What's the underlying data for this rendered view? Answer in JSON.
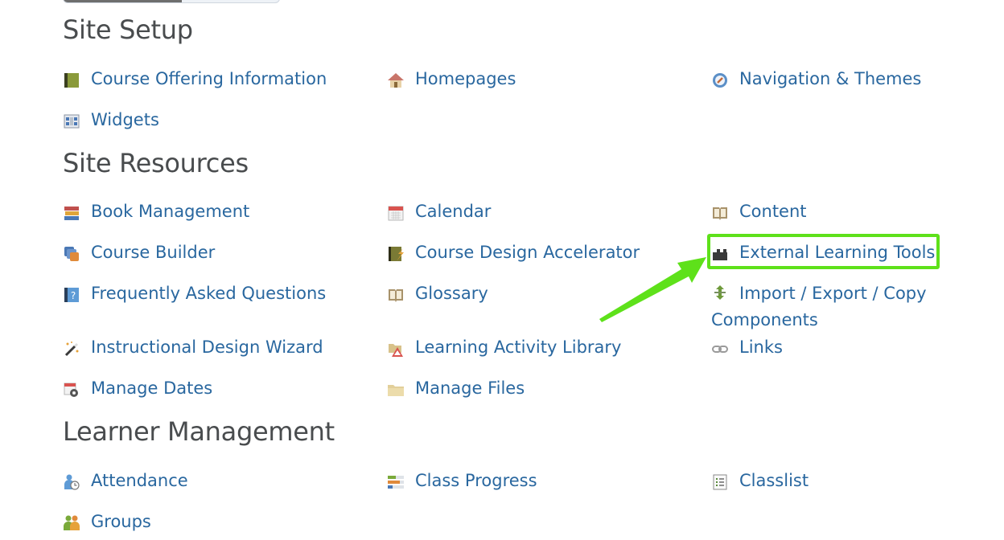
{
  "top_control": {
    "fill_fraction": 0.55
  },
  "sections": [
    {
      "title": "Site Setup",
      "items": [
        {
          "label": "Course Offering Information",
          "icon": "green-book-icon"
        },
        {
          "label": "Homepages",
          "icon": "house-icon"
        },
        {
          "label": "Navigation & Themes",
          "icon": "compass-icon"
        },
        {
          "label": "Widgets",
          "icon": "widgets-grid-icon"
        }
      ]
    },
    {
      "title": "Site Resources",
      "items": [
        {
          "label": "Book Management",
          "icon": "book-stack-icon"
        },
        {
          "label": "Calendar",
          "icon": "calendar-icon"
        },
        {
          "label": "Content",
          "icon": "open-book-icon"
        },
        {
          "label": "Course Builder",
          "icon": "course-builder-icon"
        },
        {
          "label": "Course Design Accelerator",
          "icon": "book-spark-icon"
        },
        {
          "label": "External Learning Tools",
          "icon": "puzzle-piece-icon"
        },
        {
          "label": "Frequently Asked Questions",
          "icon": "question-book-icon"
        },
        {
          "label": "Glossary",
          "icon": "open-book-icon"
        },
        {
          "label": "Import / Export / Copy Components",
          "icon": "import-export-arrows-icon"
        },
        {
          "label": "Instructional Design Wizard",
          "icon": "magic-wand-icon"
        },
        {
          "label": "Learning Activity Library",
          "icon": "activity-library-icon"
        },
        {
          "label": "Links",
          "icon": "chain-link-icon"
        },
        {
          "label": "Manage Dates",
          "icon": "calendar-gear-icon"
        },
        {
          "label": "Manage Files",
          "icon": "folder-icon"
        }
      ]
    },
    {
      "title": "Learner Management",
      "items": [
        {
          "label": "Attendance",
          "icon": "user-clock-icon"
        },
        {
          "label": "Class Progress",
          "icon": "progress-bars-icon"
        },
        {
          "label": "Classlist",
          "icon": "list-icon"
        },
        {
          "label": "Groups",
          "icon": "group-users-icon"
        }
      ]
    }
  ],
  "annotation": {
    "highlight_color": "#5ee11a",
    "highlighted_item": "External Learning Tools"
  },
  "colors": {
    "link": "#29679f",
    "heading": "#494c4e"
  }
}
